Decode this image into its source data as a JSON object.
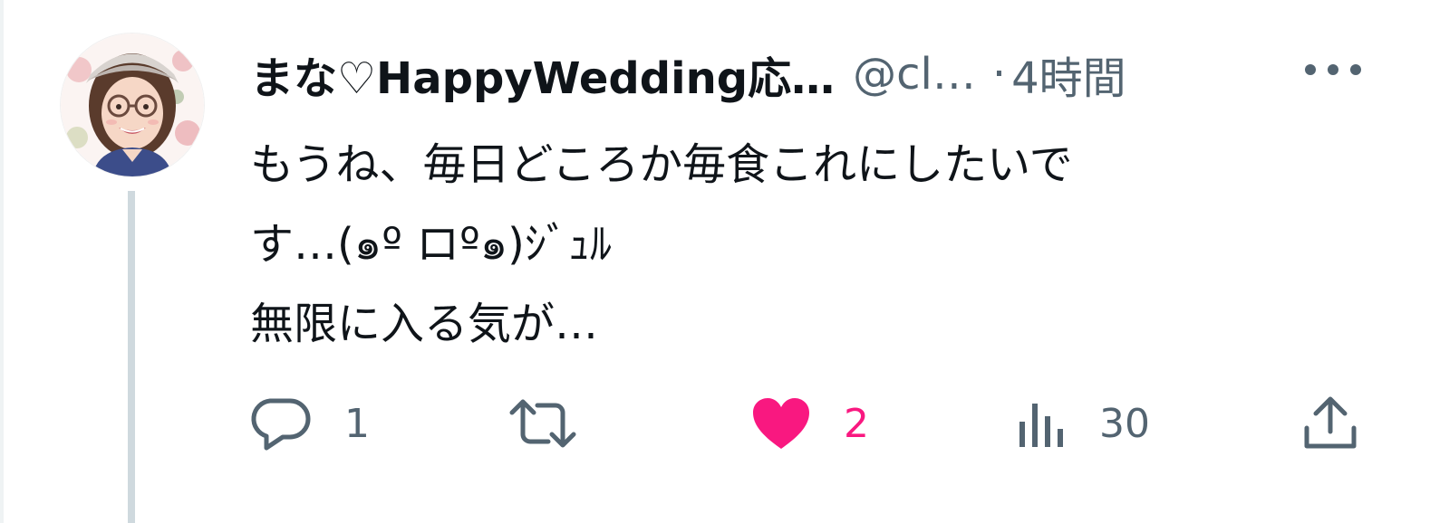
{
  "tweet": {
    "display_name": "まな♡HappyWedding応…",
    "handle": "@cl…",
    "separator": "·",
    "time": "4時間",
    "body": "もうね、毎日どころか毎食これにしたいで\nす…(๑º ロº๑)ｼﾞｭﾙ\n無限に入る気が…",
    "avatar_icon": "profile-photo",
    "more_icon": "more-horizontal-icon"
  },
  "actions": {
    "reply": {
      "icon": "reply-icon",
      "count": "1"
    },
    "retweet": {
      "icon": "retweet-icon",
      "count": ""
    },
    "like": {
      "icon": "heart-filled-icon",
      "count": "2",
      "liked": true
    },
    "views": {
      "icon": "analytics-icon",
      "count": "30"
    },
    "share": {
      "icon": "share-icon",
      "count": ""
    }
  },
  "colors": {
    "text_primary": "#0f1419",
    "text_secondary": "#536471",
    "like_pink": "#f91880",
    "thread_line": "#cfd9de"
  }
}
